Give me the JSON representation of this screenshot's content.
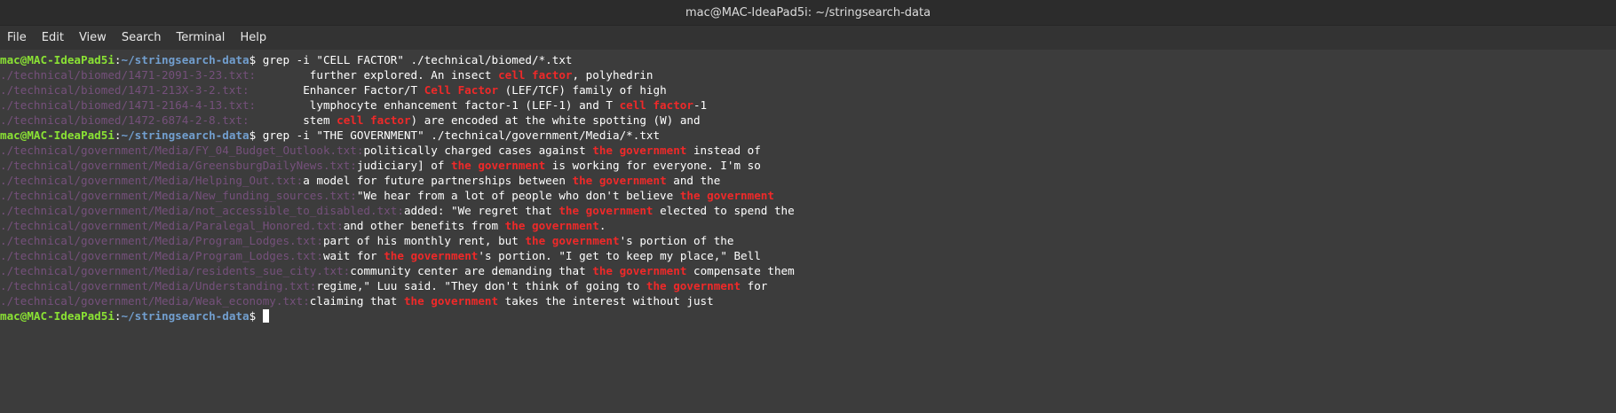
{
  "window": {
    "title": "mac@MAC-IdeaPad5i: ~/stringsearch-data"
  },
  "menu": [
    "File",
    "Edit",
    "View",
    "Search",
    "Terminal",
    "Help"
  ],
  "prompt": {
    "user_host": "mac@MAC-IdeaPad5i",
    "sep": ":",
    "path": "~/stringsearch-data",
    "symbol": "$ "
  },
  "colors": {
    "prompt_user": "#8ae234",
    "prompt_path": "#729fcf",
    "filename": "#75507b",
    "match": "#ef2929",
    "background": "#3c3c3c"
  },
  "lines": [
    {
      "kind": "prompt",
      "cmd": "grep -i \"CELL FACTOR\" ./technical/biomed/*.txt"
    },
    {
      "kind": "result",
      "file": "./technical/biomed/1471-2091-3-23.txt:",
      "parts": [
        "        further explored. An insect ",
        {
          "m": "cell factor"
        },
        ", polyhedrin"
      ]
    },
    {
      "kind": "result",
      "file": "./technical/biomed/1471-213X-3-2.txt:",
      "parts": [
        "        Enhancer Factor/T ",
        {
          "m": "Cell Factor"
        },
        " (LEF/TCF) family of high"
      ]
    },
    {
      "kind": "result",
      "file": "./technical/biomed/1471-2164-4-13.txt:",
      "parts": [
        "        lymphocyte enhancement factor-1 (LEF-1) and T ",
        {
          "m": "cell factor"
        },
        "-1"
      ]
    },
    {
      "kind": "result",
      "file": "./technical/biomed/1472-6874-2-8.txt:",
      "parts": [
        "        stem ",
        {
          "m": "cell factor"
        },
        ") are encoded at the white spotting (W) and"
      ]
    },
    {
      "kind": "prompt",
      "cmd": "grep -i \"THE GOVERNMENT\" ./technical/government/Media/*.txt"
    },
    {
      "kind": "result",
      "file": "./technical/government/Media/FY_04_Budget_Outlook.txt:",
      "parts": [
        "politically charged cases against ",
        {
          "m": "the government"
        },
        " instead of"
      ]
    },
    {
      "kind": "result",
      "file": "./technical/government/Media/GreensburgDailyNews.txt:",
      "parts": [
        "judiciary] of ",
        {
          "m": "the government"
        },
        " is working for everyone. I'm so"
      ]
    },
    {
      "kind": "result",
      "file": "./technical/government/Media/Helping_Out.txt:",
      "parts": [
        "a model for future partnerships between ",
        {
          "m": "the government"
        },
        " and the"
      ]
    },
    {
      "kind": "result",
      "file": "./technical/government/Media/New_funding_sources.txt:",
      "parts": [
        "\"We hear from a lot of people who don't believe ",
        {
          "m": "the government"
        }
      ]
    },
    {
      "kind": "result",
      "file": "./technical/government/Media/not_accessible_to_disabled.txt:",
      "parts": [
        "added: \"We regret that ",
        {
          "m": "the government"
        },
        " elected to spend the"
      ]
    },
    {
      "kind": "result",
      "file": "./technical/government/Media/Paralegal_Honored.txt:",
      "parts": [
        "and other benefits from ",
        {
          "m": "the government"
        },
        "."
      ]
    },
    {
      "kind": "result",
      "file": "./technical/government/Media/Program_Lodges.txt:",
      "parts": [
        "part of his monthly rent, but ",
        {
          "m": "the government"
        },
        "'s portion of the"
      ]
    },
    {
      "kind": "result",
      "file": "./technical/government/Media/Program_Lodges.txt:",
      "parts": [
        "wait for ",
        {
          "m": "the government"
        },
        "'s portion. \"I get to keep my place,\" Bell"
      ]
    },
    {
      "kind": "result",
      "file": "./technical/government/Media/residents_sue_city.txt:",
      "parts": [
        "community center are demanding that ",
        {
          "m": "the government"
        },
        " compensate them"
      ]
    },
    {
      "kind": "result",
      "file": "./technical/government/Media/Understanding.txt:",
      "parts": [
        "regime,\" Luu said. \"They don't think of going to ",
        {
          "m": "the government"
        },
        " for"
      ]
    },
    {
      "kind": "result",
      "file": "./technical/government/Media/Weak_economy.txt:",
      "parts": [
        "claiming that ",
        {
          "m": "the government"
        },
        " takes the interest without just"
      ]
    },
    {
      "kind": "prompt",
      "cmd": "",
      "cursor": true
    }
  ]
}
